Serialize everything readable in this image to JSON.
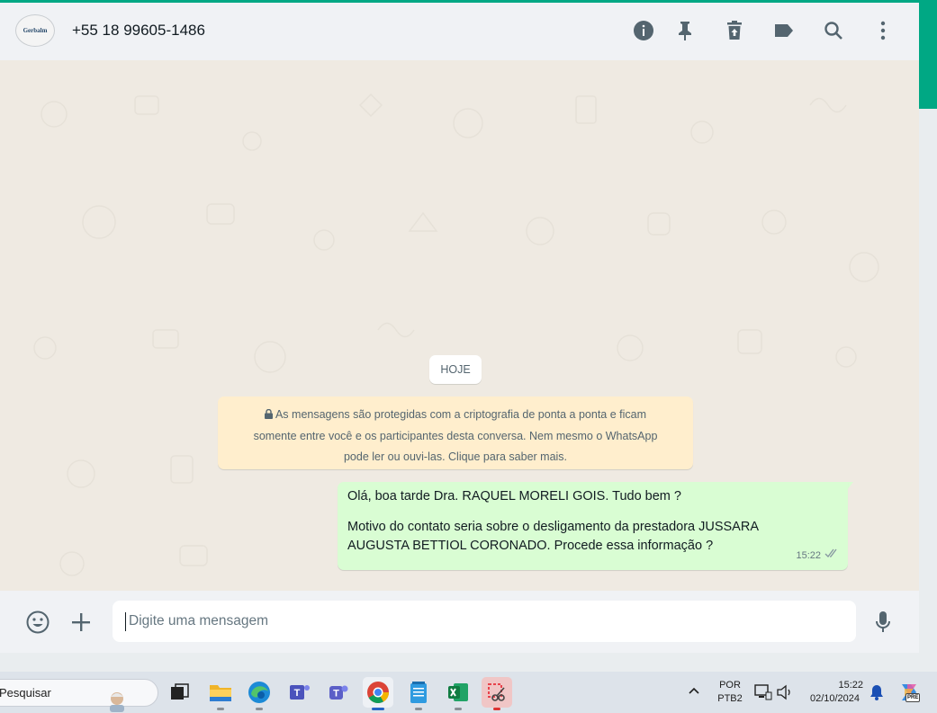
{
  "header": {
    "contact_name": "+55 18 99605-1486",
    "avatar_text": "Gerbalm",
    "icons": [
      "info-icon",
      "pin-icon",
      "delete-icon",
      "label-icon",
      "search-icon",
      "menu-icon"
    ]
  },
  "chat": {
    "date_label": "HOJE",
    "encryption_notice": {
      "line1": "As mensagens são protegidas com a criptografia de ponta a ponta e ficam",
      "line2": "somente entre você e os participantes desta conversa. Nem mesmo o WhatsApp",
      "line3": "pode ler ou ouvi-las. Clique para saber mais."
    },
    "messages": [
      {
        "direction": "outgoing",
        "lines": [
          "Olá, boa tarde Dra. RAQUEL MORELI GOIS. Tudo bem ?",
          "Motivo do contato seria sobre o desligamento da prestadora JUSSARA",
          "AUGUSTA BETTIOL CORONADO. Procede essa informação ?"
        ],
        "time": "15:22",
        "status": "delivered"
      }
    ]
  },
  "composer": {
    "placeholder": "Digite uma mensagem",
    "value": ""
  },
  "taskbar": {
    "search_placeholder": "Pesquisar",
    "language_line1": "POR",
    "language_line2": "PTB2",
    "time": "15:22",
    "date": "02/10/2024",
    "copilot_badge": "PRE"
  },
  "colors": {
    "accent": "#00a884",
    "header_bg": "#f0f2f5",
    "chat_bg": "#efeae2",
    "outgoing_bubble": "#d9fdd3",
    "notice_bg": "#ffeecd"
  }
}
